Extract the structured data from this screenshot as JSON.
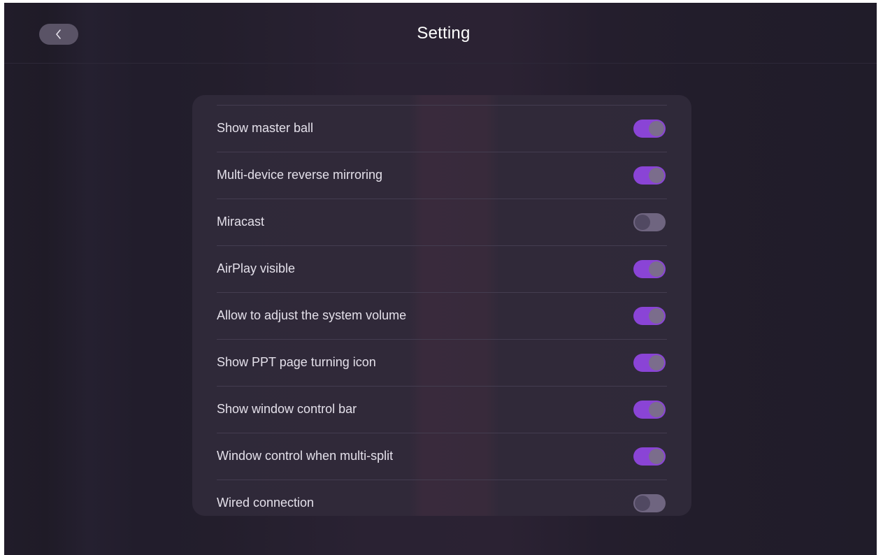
{
  "header": {
    "title": "Setting",
    "back_icon": "chevron-left-icon"
  },
  "settings": [
    {
      "label": "Show master ball",
      "enabled": true
    },
    {
      "label": "Multi-device reverse mirroring",
      "enabled": true
    },
    {
      "label": "Miracast",
      "enabled": false
    },
    {
      "label": "AirPlay visible",
      "enabled": true
    },
    {
      "label": "Allow to adjust the system volume",
      "enabled": true
    },
    {
      "label": "Show PPT page turning icon",
      "enabled": true
    },
    {
      "label": "Show window control bar",
      "enabled": true
    },
    {
      "label": "Window control when multi-split",
      "enabled": true
    },
    {
      "label": "Wired connection",
      "enabled": false
    }
  ],
  "colors": {
    "accent": "#8a44d6",
    "toggle_off": "#6f6580"
  }
}
